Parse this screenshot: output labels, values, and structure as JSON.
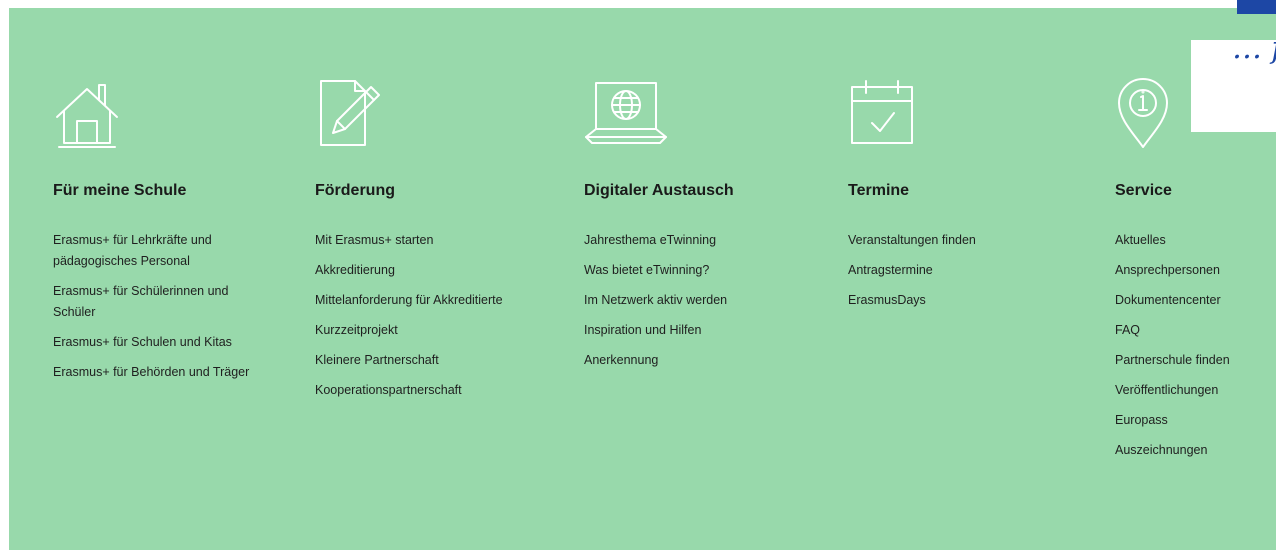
{
  "colors": {
    "panel": "#98d9ab",
    "brand": "#1d47a5",
    "icon_stroke": "#ffffff"
  },
  "brand": {
    "text": "… f"
  },
  "columns": [
    {
      "icon": "house-icon",
      "title": "Für meine Schule",
      "links": [
        "Erasmus+ für Lehrkräfte und pädagogisches Personal",
        "Erasmus+ für Schülerinnen und Schüler",
        "Erasmus+ für Schulen und Kitas",
        "Erasmus+ für Behörden und Träger"
      ]
    },
    {
      "icon": "document-pencil-icon",
      "title": "Förderung",
      "links": [
        "Mit Erasmus+ starten",
        "Akkreditierung",
        "Mittelanforderung für Akkreditierte",
        "Kurzzeitprojekt",
        "Kleinere Partnerschaft",
        "Kooperationspartnerschaft"
      ]
    },
    {
      "icon": "laptop-globe-icon",
      "title": "Digitaler Austausch",
      "links": [
        "Jahresthema eTwinning",
        "Was bietet eTwinning?",
        "Im Netzwerk aktiv werden",
        "Inspiration und Hilfen",
        "Anerkennung"
      ]
    },
    {
      "icon": "calendar-check-icon",
      "title": "Termine",
      "links": [
        "Veranstaltungen finden",
        "Antragstermine",
        "ErasmusDays"
      ]
    },
    {
      "icon": "location-info-icon",
      "title": "Service",
      "links": [
        "Aktuelles",
        "Ansprechpersonen",
        "Dokumentencenter",
        "FAQ",
        "Partnerschule finden",
        "Veröffentlichungen",
        "Europass",
        "Auszeichnungen"
      ]
    }
  ]
}
